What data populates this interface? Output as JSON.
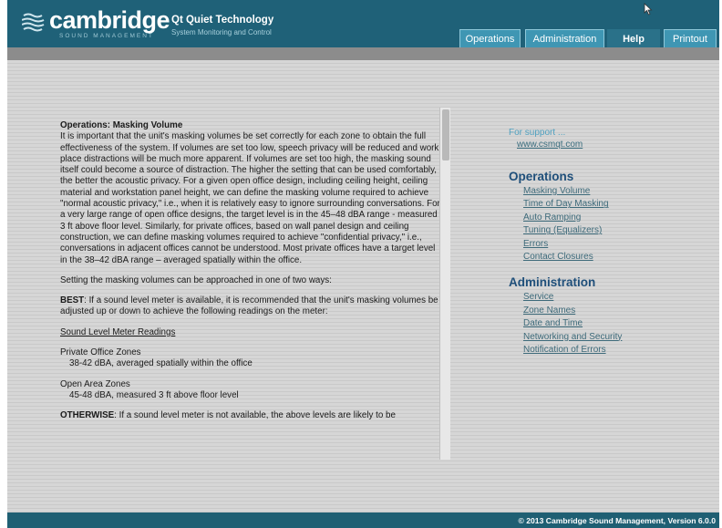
{
  "header": {
    "brand": "cambridge",
    "brand_sub": "SOUND MANAGEMENT",
    "product": "Qt Quiet Technology",
    "product_sub": "System Monitoring and Control",
    "tabs": [
      "Operations",
      "Administration",
      "Help",
      "Printout"
    ],
    "active_tab": "Help"
  },
  "content": {
    "title": "Operations: Masking Volume",
    "para1": "It is important that the unit's masking volumes be set correctly for each zone to obtain the full effectiveness of the system. If volumes are set too low, speech privacy will be reduced and work place distractions will be much more apparent. If volumes are set too high, the masking sound itself could become a source of distraction. The higher the setting that can be used comfortably, the better the acoustic privacy. For a given open office design, including ceiling height, ceiling material and workstation panel height, we can define the masking volume required to achieve \"normal acoustic privacy,\" i.e., when it is relatively easy to ignore surrounding conversations. For a very large range of open office designs, the target level is in the 45–48 dBA range - measured 3 ft above floor level. Similarly, for private offices, based on wall panel design and ceiling construction, we can define masking volumes required to achieve \"confidential privacy,\" i.e., conversations in adjacent offices cannot be understood. Most private offices have a target level in the 38–42 dBA range – averaged spatially within the office.",
    "para2": "Setting the masking volumes can be approached in one of two ways:",
    "best_label": "BEST",
    "best_text": ": If a sound level meter is available, it is recommended that the unit's masking volumes be adjusted up or down to achieve the following readings on the meter:",
    "meter_heading": "Sound Level Meter Readings",
    "private_label": "Private Office Zones",
    "private_value": "38-42 dBA, averaged spatially within the office",
    "open_label": "Open Area Zones",
    "open_value": "45-48 dBA, measured 3 ft above floor level",
    "otherwise_label": "OTHERWISE",
    "otherwise_text": ": If a sound level meter is not available, the above levels are likely to be"
  },
  "sidebar": {
    "support_label": "For support ...",
    "support_link": "www.csmqt.com",
    "operations_title": "Operations",
    "operations_items": [
      "Masking Volume",
      "Time of Day Masking",
      "Auto Ramping",
      "Tuning (Equalizers)",
      "Errors",
      "Contact Closures"
    ],
    "administration_title": "Administration",
    "administration_items": [
      "Service",
      "Zone Names",
      "Date and Time",
      "Networking and Security",
      "Notification of Errors"
    ]
  },
  "footer": {
    "copyright": "© 2013  Cambridge Sound Management,  Version 6.0.0"
  }
}
